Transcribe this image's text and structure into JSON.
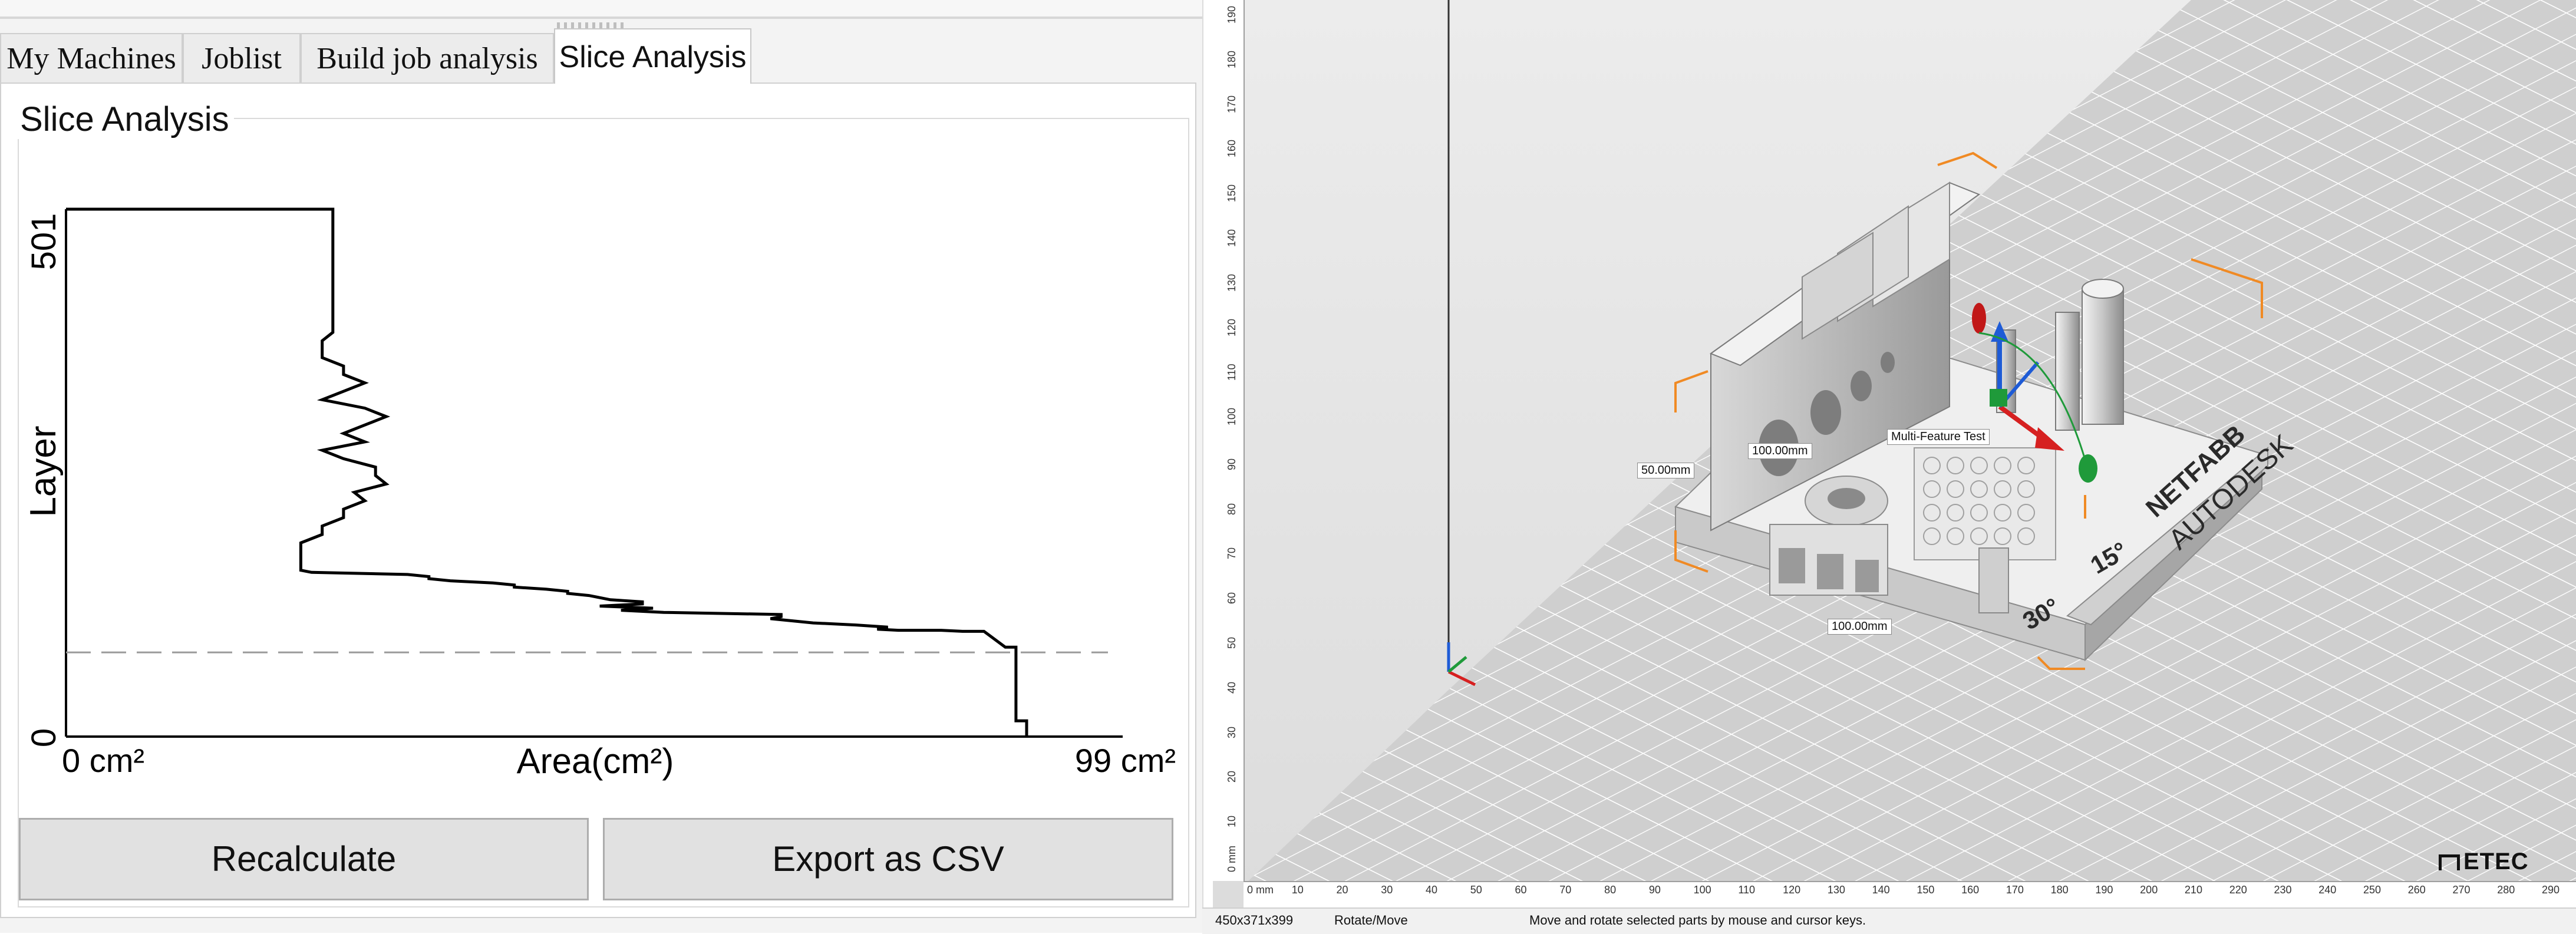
{
  "tabs": [
    "My Machines",
    "Joblist",
    "Build job analysis",
    "Slice Analysis"
  ],
  "active_tab": "Slice Analysis",
  "slice_analysis": {
    "group_title": "Slice Analysis",
    "buttons": {
      "recalculate": "Recalculate",
      "export_csv": "Export as CSV"
    },
    "line_color": "#000000",
    "reference_line_color": "#9a9a9a"
  },
  "chart_data": {
    "type": "line",
    "xlabel": "Area(cm²)",
    "ylabel": "Layer",
    "x_tick_labels": [
      "0 cm²",
      "99 cm²"
    ],
    "y_tick_labels": [
      "501",
      "0"
    ],
    "xlim": [
      0,
      99
    ],
    "ylim": [
      0,
      501
    ],
    "reference_line_layer": 80,
    "series": [
      {
        "x": [
          90,
          90,
          89,
          89,
          88,
          86,
          84,
          82,
          78,
          76,
          77,
          74,
          70,
          68,
          66,
          67,
          67,
          56,
          52,
          55,
          50,
          54,
          54,
          51,
          50,
          49,
          47,
          47,
          45,
          42,
          42,
          40,
          36,
          34,
          34,
          32,
          23,
          22,
          22,
          22,
          22,
          22,
          24,
          24,
          26,
          26,
          28,
          27,
          30,
          29,
          29,
          26,
          24,
          28,
          26,
          28,
          30,
          28,
          24,
          26,
          28,
          26,
          26,
          24,
          24,
          24,
          25,
          25,
          25,
          25,
          25,
          25,
          25,
          25
        ],
        "y": [
          0,
          15,
          15,
          85,
          85,
          100,
          100,
          101,
          101,
          102,
          104,
          106,
          108,
          110,
          112,
          114,
          116,
          118,
          120,
          122,
          124,
          126,
          128,
          130,
          132,
          134,
          136,
          138,
          140,
          142,
          144,
          146,
          148,
          150,
          152,
          154,
          156,
          158,
          160,
          168,
          176,
          184,
          192,
          200,
          208,
          216,
          224,
          232,
          240,
          248,
          256,
          264,
          272,
          280,
          288,
          296,
          304,
          312,
          320,
          328,
          336,
          344,
          352,
          360,
          368,
          376,
          384,
          392,
          400,
          440,
          470,
          490,
          500,
          501
        ]
      }
    ]
  },
  "viewport": {
    "tooltip_label": "Multi-Feature Test",
    "dimension_labels": [
      "100.00mm",
      "50.00mm",
      "100.00mm"
    ],
    "model_texts": [
      "NETFABB",
      "AUTODESK",
      "15°",
      "30°"
    ],
    "ruler_left_ticks": [
      "0 mm",
      "10",
      "20",
      "30",
      "40",
      "50",
      "60",
      "70",
      "80",
      "90",
      "100",
      "110",
      "120",
      "130",
      "140",
      "150",
      "160",
      "170",
      "180",
      "190"
    ],
    "ruler_bottom_ticks": [
      "0 mm",
      "10",
      "20",
      "30",
      "40",
      "50",
      "60",
      "70",
      "80",
      "90",
      "100",
      "110",
      "120",
      "130",
      "140",
      "150",
      "160",
      "170",
      "180",
      "190",
      "200",
      "210",
      "220",
      "230",
      "240",
      "250",
      "260",
      "270",
      "280",
      "290"
    ],
    "logo": "ETEC",
    "accent_orange": "#f08a24"
  },
  "statusbar": {
    "dimensions": "450x371x399",
    "mode": "Rotate/Move",
    "hint": "Move and rotate selected parts by mouse and cursor keys."
  }
}
